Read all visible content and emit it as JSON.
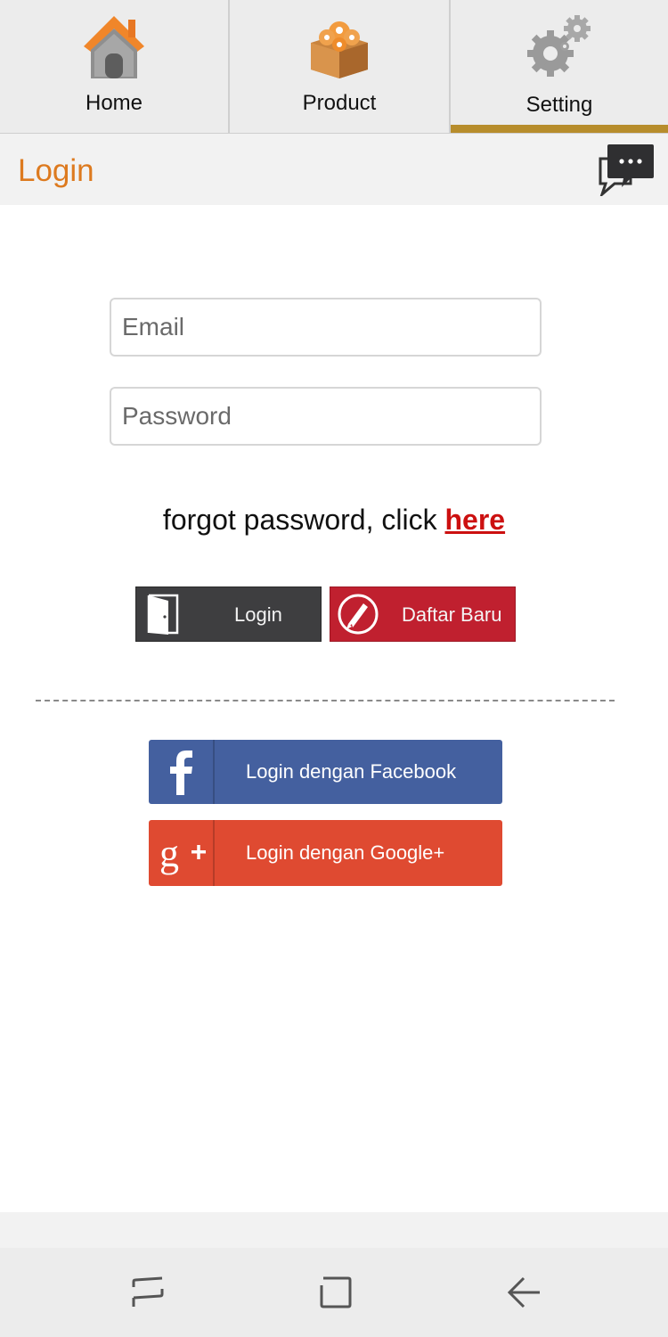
{
  "tabs": [
    {
      "label": "Home",
      "icon": "house-icon",
      "active": false
    },
    {
      "label": "Product",
      "icon": "box-icon",
      "active": false
    },
    {
      "label": "Setting",
      "icon": "gears-icon",
      "active": true
    }
  ],
  "header": {
    "title": "Login",
    "chat_icon": "chat-bubbles-icon"
  },
  "form": {
    "email_placeholder": "Email",
    "email_value": "",
    "password_placeholder": "Password",
    "password_value": ""
  },
  "forgot": {
    "text": "forgot password, click ",
    "link": "here"
  },
  "buttons": {
    "login": "Login",
    "register": "Daftar Baru"
  },
  "social": {
    "facebook": "Login dengan Facebook",
    "google": "Login dengan Google+"
  },
  "navbar": {
    "recent_icon": "recent-apps-icon",
    "home_icon": "home-square-icon",
    "back_icon": "back-arrow-icon"
  },
  "colors": {
    "accent_orange": "#dd7a1f",
    "active_tab_bar": "#b78d2c",
    "link_red": "#cc1010",
    "login_dark": "#3e3e40",
    "register_red": "#c0202f",
    "facebook_blue": "#44609f",
    "google_red": "#df4a31"
  }
}
